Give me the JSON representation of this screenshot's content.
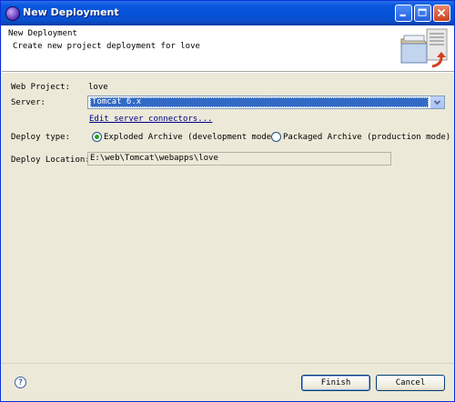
{
  "window": {
    "title": "New Deployment"
  },
  "header": {
    "title": "New Deployment",
    "description": "Create new project deployment for love"
  },
  "form": {
    "web_project_label": "Web Project:",
    "web_project_value": "love",
    "server_label": "Server:",
    "server_selected": "Tomcat  6.x",
    "edit_server_link": "Edit server connectors...",
    "deploy_type_label": "Deploy type:",
    "deploy_type_options": [
      "Exploded Archive (development mode)",
      "Packaged Archive (production mode)"
    ],
    "deploy_type_selected": "Exploded Archive (development mode)",
    "deploy_location_label": "Deploy Location:",
    "deploy_location_value": "E:\\web\\Tomcat\\webapps\\love"
  },
  "footer": {
    "help_symbol": "?",
    "finish_label": "Finish",
    "cancel_label": "Cancel"
  },
  "colors": {
    "titlebar": "#0553d6",
    "selection": "#316ac5",
    "link": "#00008b",
    "radio_dot": "#21a121",
    "window_bg": "#ece9d8"
  },
  "icons": [
    "eclipse-app-icon",
    "minimize-icon",
    "maximize-icon",
    "close-icon",
    "deployment-banner-icon",
    "combo-arrow-icon",
    "help-icon"
  ]
}
